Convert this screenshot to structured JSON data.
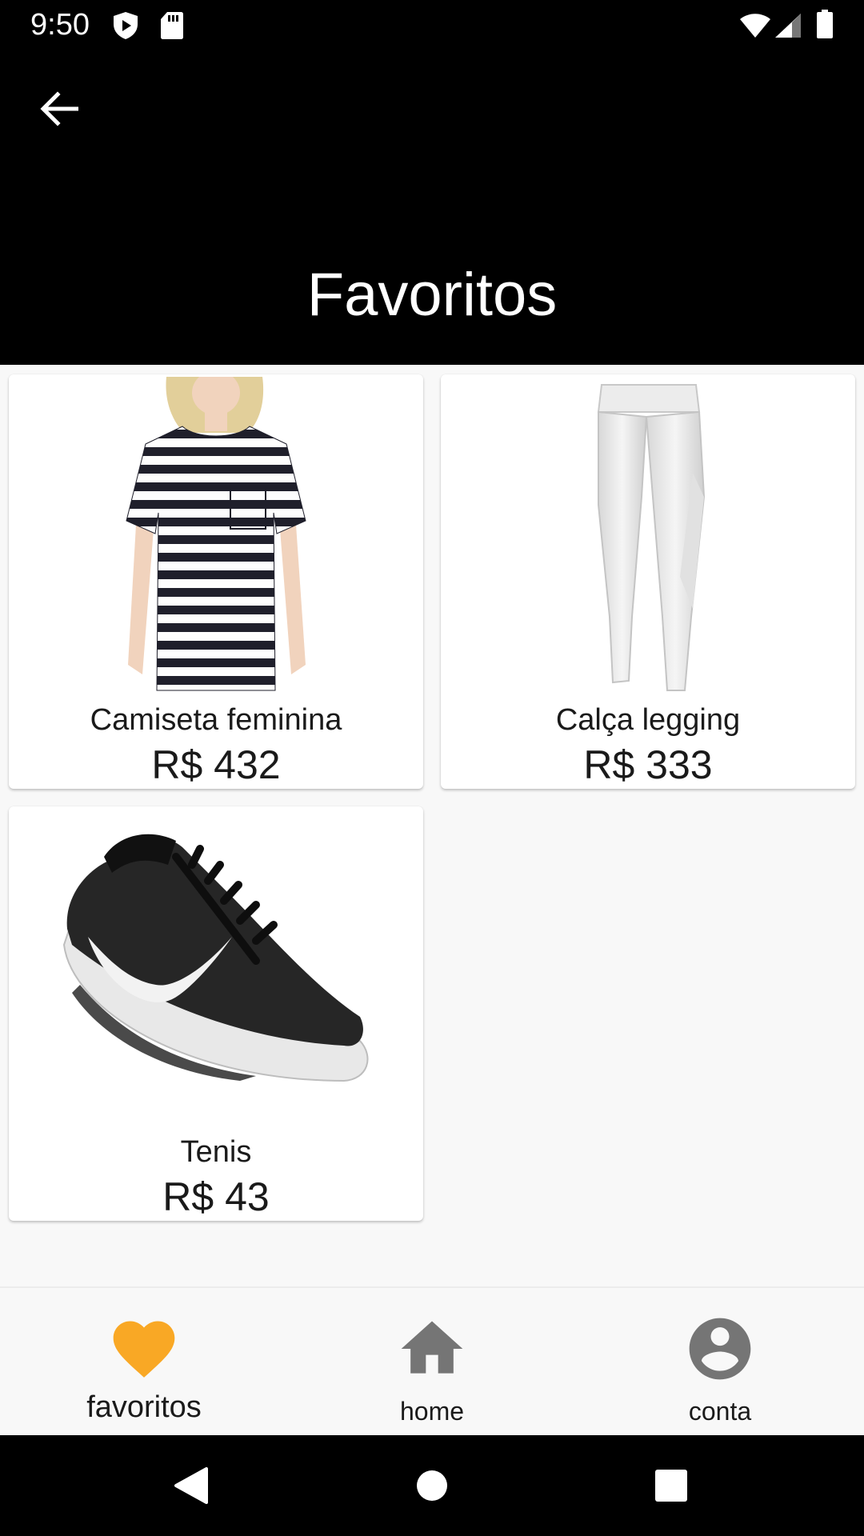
{
  "status_bar": {
    "time": "9:50",
    "icons": [
      "shield-play-icon",
      "sd-card-icon",
      "wifi-icon",
      "signal-icon",
      "battery-icon"
    ]
  },
  "app_bar": {
    "back_icon": "arrow-back-icon",
    "title": "Favoritos"
  },
  "products": [
    {
      "name": "Camiseta feminina",
      "price": "R$ 432",
      "image": "striped-tshirt"
    },
    {
      "name": "Calça legging",
      "price": "R$ 333",
      "image": "white-leggings"
    },
    {
      "name": "Tenis",
      "price": "R$ 43",
      "image": "black-sneaker"
    }
  ],
  "bottom_nav": {
    "items": [
      {
        "label": "favoritos",
        "icon": "heart-icon",
        "active": true
      },
      {
        "label": "home",
        "icon": "home-icon",
        "active": false
      },
      {
        "label": "conta",
        "icon": "account-circle-icon",
        "active": false
      }
    ]
  },
  "colors": {
    "accent": "#f9a825",
    "inactive_icon": "#757575",
    "app_bar_bg": "#000000",
    "page_bg": "#f8f8f8"
  },
  "system_nav": {
    "icons": [
      "back-triangle-icon",
      "home-circle-icon",
      "recents-square-icon"
    ]
  }
}
